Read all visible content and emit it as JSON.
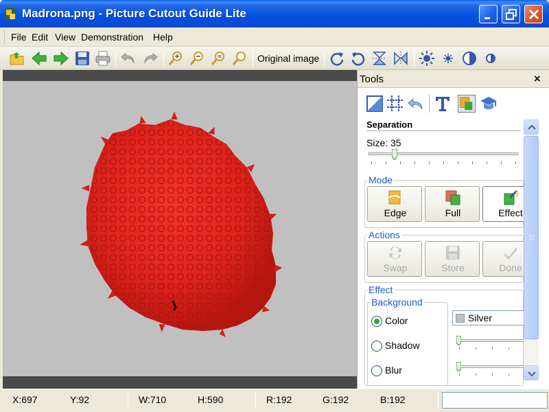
{
  "window": {
    "title": "Madrona.png - Picture Cutout Guide Lite",
    "controls": {
      "minimize": "minimize-icon",
      "maximize": "maximize-icon",
      "close": "close-icon"
    }
  },
  "menu": [
    "File",
    "Edit",
    "View",
    "Demonstration",
    "Help"
  ],
  "toolbar": {
    "icons": [
      "open-icon",
      "back-arrow-icon",
      "forward-arrow-icon",
      "save-icon",
      "print-icon",
      "undo-icon",
      "redo-icon",
      "zoom-in-icon",
      "zoom-out-icon",
      "zoom-fit-icon",
      "zoom-actual-icon",
      "rotate-right-icon",
      "rotate-left-icon",
      "flip-vertical-icon",
      "flip-horizontal-icon",
      "brightness-icon",
      "brightness-small-icon",
      "contrast-icon",
      "contrast-small-icon"
    ],
    "original_image_label": "Original image"
  },
  "canvas": {
    "background_color": "#c0c0c0",
    "subject_color": "#e52a1e"
  },
  "tools": {
    "title": "Tools",
    "close": "×",
    "separation": {
      "title": "Separation",
      "size_label": "Size: 35",
      "size_value": 35
    },
    "mode": {
      "label": "Mode",
      "buttons": [
        {
          "label": "Edge",
          "icon": "edge-mode-icon"
        },
        {
          "label": "Full",
          "icon": "full-mode-icon"
        },
        {
          "label": "Effect",
          "icon": "effect-mode-icon"
        }
      ]
    },
    "actions": {
      "label": "Actions",
      "buttons": [
        {
          "label": "Swap",
          "icon": "swap-icon"
        },
        {
          "label": "Store",
          "icon": "store-icon"
        },
        {
          "label": "Done",
          "icon": "done-icon"
        }
      ]
    },
    "effect": {
      "label": "Effect",
      "background": {
        "label": "Background",
        "options": [
          {
            "label": "Color",
            "checked": true
          },
          {
            "label": "Shadow",
            "checked": false
          },
          {
            "label": "Blur",
            "checked": false
          }
        ],
        "color_value": "Silver"
      }
    }
  },
  "status": {
    "x": "X:697",
    "y": "Y:92",
    "w": "W:710",
    "h": "H:590",
    "r": "R:192",
    "g": "G:192",
    "b": "B:192"
  }
}
